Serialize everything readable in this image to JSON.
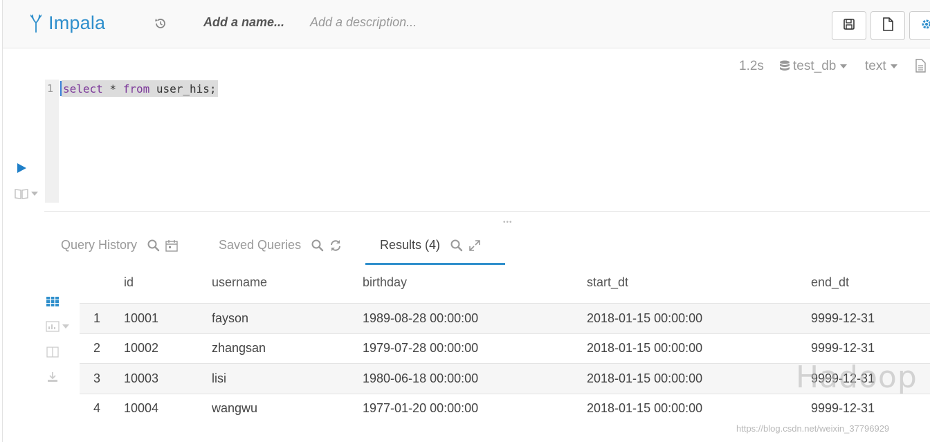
{
  "header": {
    "app_name": "Impala",
    "name_placeholder": "Add a name...",
    "description_placeholder": "Add a description..."
  },
  "editor": {
    "exec_time": "1.2s",
    "database": "test_db",
    "type": "text",
    "line_number": "1",
    "code": {
      "kw1": "select",
      "star": " * ",
      "kw2": "from",
      "rest": " user_his;"
    }
  },
  "tabs": {
    "history": "Query History",
    "saved": "Saved Queries",
    "results": "Results (4)"
  },
  "table": {
    "columns": [
      "id",
      "username",
      "birthday",
      "start_dt",
      "end_dt"
    ],
    "rows": [
      {
        "n": "1",
        "id": "10001",
        "username": "fayson",
        "birthday": "1989-08-28 00:00:00",
        "start_dt": "2018-01-15 00:00:00",
        "end_dt": "9999-12-31"
      },
      {
        "n": "2",
        "id": "10002",
        "username": "zhangsan",
        "birthday": "1979-07-28 00:00:00",
        "start_dt": "2018-01-15 00:00:00",
        "end_dt": "9999-12-31"
      },
      {
        "n": "3",
        "id": "10003",
        "username": "lisi",
        "birthday": "1980-06-18 00:00:00",
        "start_dt": "2018-01-15 00:00:00",
        "end_dt": "9999-12-31"
      },
      {
        "n": "4",
        "id": "10004",
        "username": "wangwu",
        "birthday": "1977-01-20 00:00:00",
        "start_dt": "2018-01-15 00:00:00",
        "end_dt": "9999-12-31"
      }
    ]
  },
  "watermark": "Hadoop",
  "footnote": "https://blog.csdn.net/weixin_37796929",
  "colors": {
    "accent": "#2f8fcc",
    "keyword": "#7d3a9a",
    "run": "#1f7fc8"
  },
  "icons": {
    "logo": "impala-logo-icon",
    "history": "history-icon",
    "save": "save-icon",
    "new": "new-document-icon",
    "settings": "gear-icon",
    "database": "database-icon",
    "doc": "document-icon",
    "run": "play-icon",
    "snippet": "book-icon",
    "search": "search-icon",
    "calendar": "calendar-icon",
    "refresh": "refresh-icon",
    "expand": "expand-icon",
    "grid": "grid-icon",
    "chart": "chart-icon",
    "columns": "columns-icon",
    "download": "download-icon"
  }
}
